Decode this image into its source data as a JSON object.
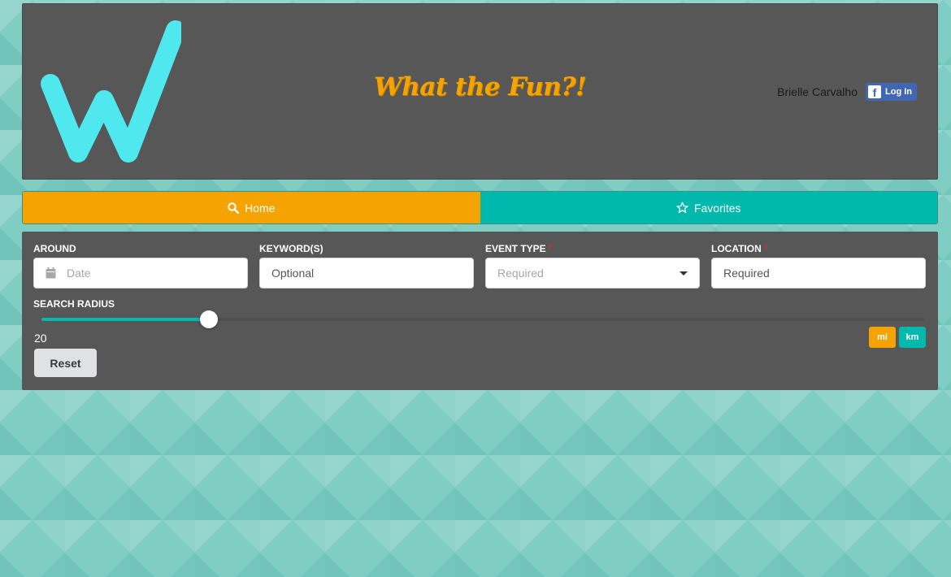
{
  "header": {
    "title": "What the Fun?!",
    "user_name": "Brielle Carvalho",
    "fb_login_label": "Log In",
    "fb_letter": "f"
  },
  "tabs": [
    {
      "label": "Home",
      "icon": "search-icon",
      "active": true
    },
    {
      "label": "Favorites",
      "icon": "star-outline-icon",
      "active": false
    }
  ],
  "form": {
    "around": {
      "label": "AROUND",
      "placeholder": "Date",
      "icon": "calendar-icon"
    },
    "keywords": {
      "label": "KEYWORD(S)",
      "placeholder": "Optional"
    },
    "event_type": {
      "label": "EVENT TYPE",
      "required_mark": "*",
      "placeholder": "Required"
    },
    "location": {
      "label": "LOCATION",
      "required_mark": "*",
      "placeholder": "Required"
    }
  },
  "radius": {
    "label": "SEARCH RADIUS",
    "value": "20",
    "fraction": 0.19,
    "units": [
      "mi",
      "km"
    ]
  },
  "reset_label": "Reset",
  "colors": {
    "accent_orange": "#f5a300",
    "accent_teal": "#00b9ad",
    "logo_cyan": "#4ee8ee",
    "panel": "#575757",
    "required": "#db2828"
  }
}
